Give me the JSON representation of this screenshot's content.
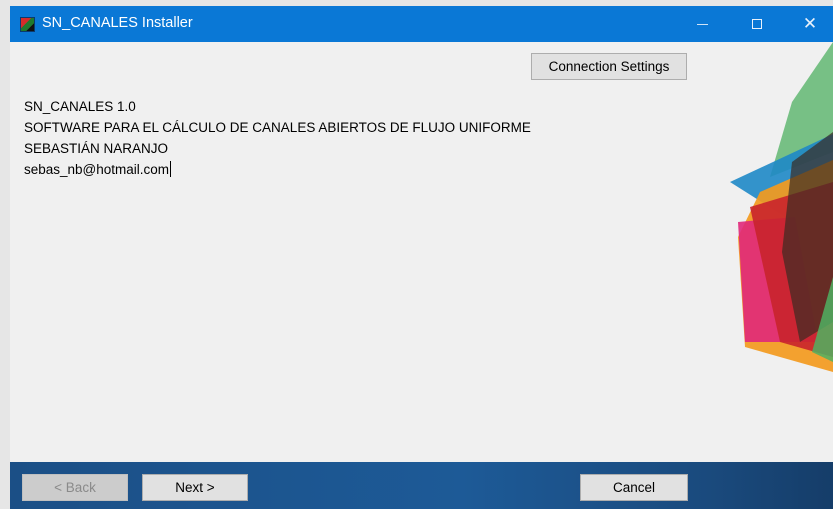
{
  "window": {
    "title": "SN_CANALES Installer",
    "controls": {
      "minimize": "–",
      "maximize": "□",
      "close": "✕"
    }
  },
  "toolbar": {
    "connection_settings_label": "Connection Settings"
  },
  "info": {
    "lines": [
      "SN_CANALES 1.0",
      "SOFTWARE PARA EL CÁLCULO DE CANALES ABIERTOS DE FLUJO UNIFORME",
      "SEBASTIÁN NARANJO",
      "sebas_nb@hotmail.com"
    ]
  },
  "footer": {
    "back_label": "< Back",
    "next_label": "Next >",
    "cancel_label": "Cancel"
  },
  "colors": {
    "titlebar": "#0a78d6",
    "footer": "#1d5a97",
    "decor_green": "#3fa34d",
    "decor_blue": "#1e88c7",
    "decor_orange": "#f39a1e",
    "decor_red": "#d92b2b",
    "decor_magenta": "#e0287a"
  }
}
